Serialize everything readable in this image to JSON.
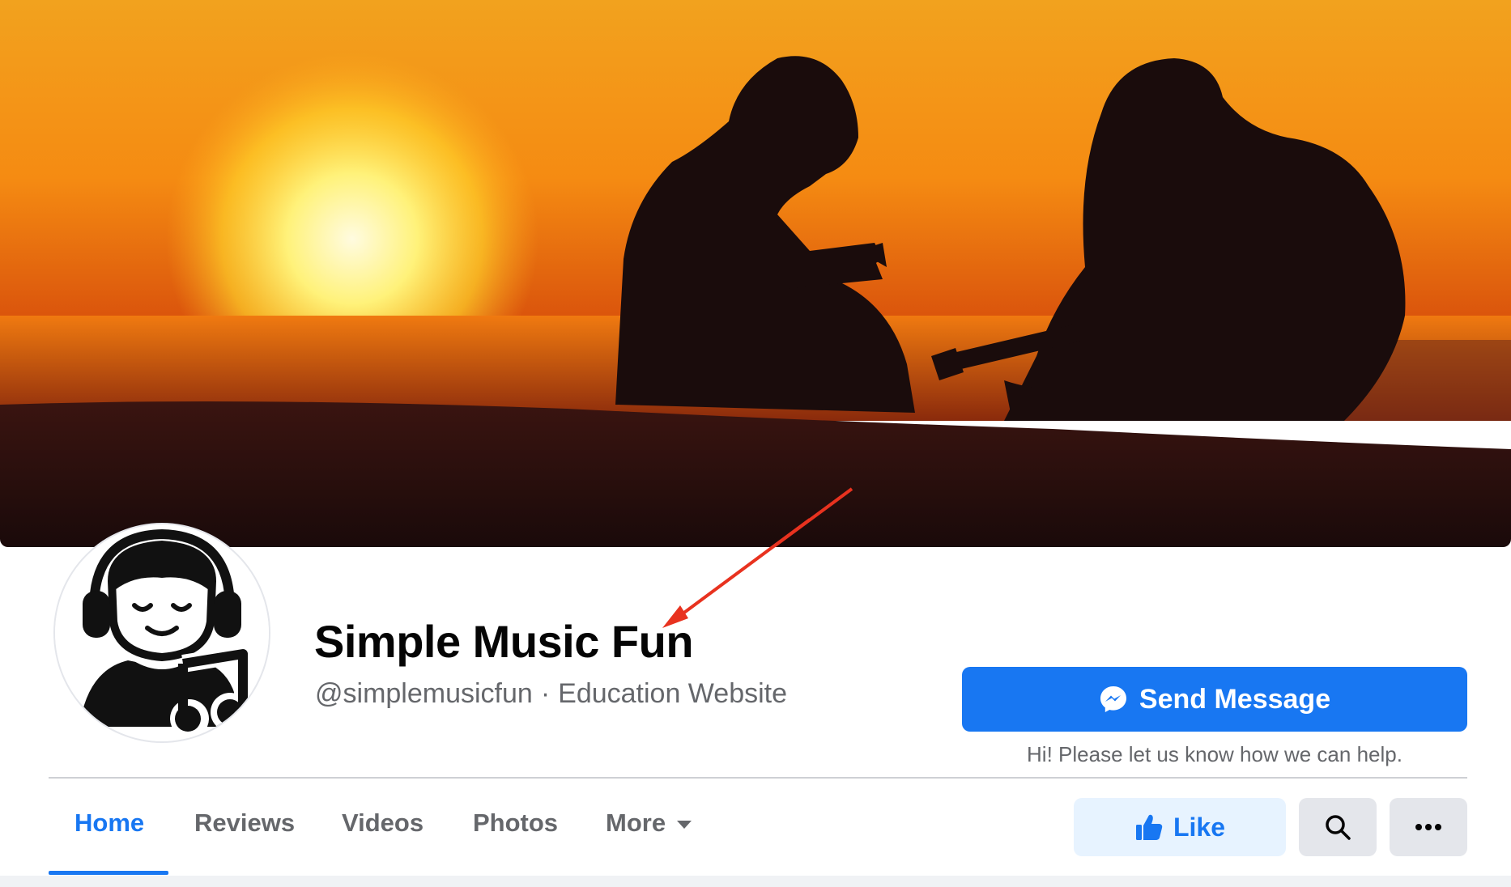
{
  "page": {
    "name": "Simple Music Fun",
    "handle": "@simplemusicfun",
    "separator": "·",
    "category": "Education Website"
  },
  "actions": {
    "send_message_label": "Send Message",
    "send_message_hint": "Hi! Please let us know how we can help.",
    "like_label": "Like"
  },
  "tabs": [
    {
      "label": "Home",
      "active": true
    },
    {
      "label": "Reviews",
      "active": false
    },
    {
      "label": "Videos",
      "active": false
    },
    {
      "label": "Photos",
      "active": false
    },
    {
      "label": "More",
      "active": false
    }
  ],
  "icons": {
    "send_message": "messenger-icon",
    "like": "thumbs-up-icon",
    "search": "search-icon",
    "more_options": "ellipsis-icon",
    "more_tab": "caret-down-icon"
  },
  "colors": {
    "accent": "#1877f2",
    "like_bg": "#e7f3ff",
    "secondary_text": "#65676b",
    "annotation_arrow": "#e8321f"
  }
}
